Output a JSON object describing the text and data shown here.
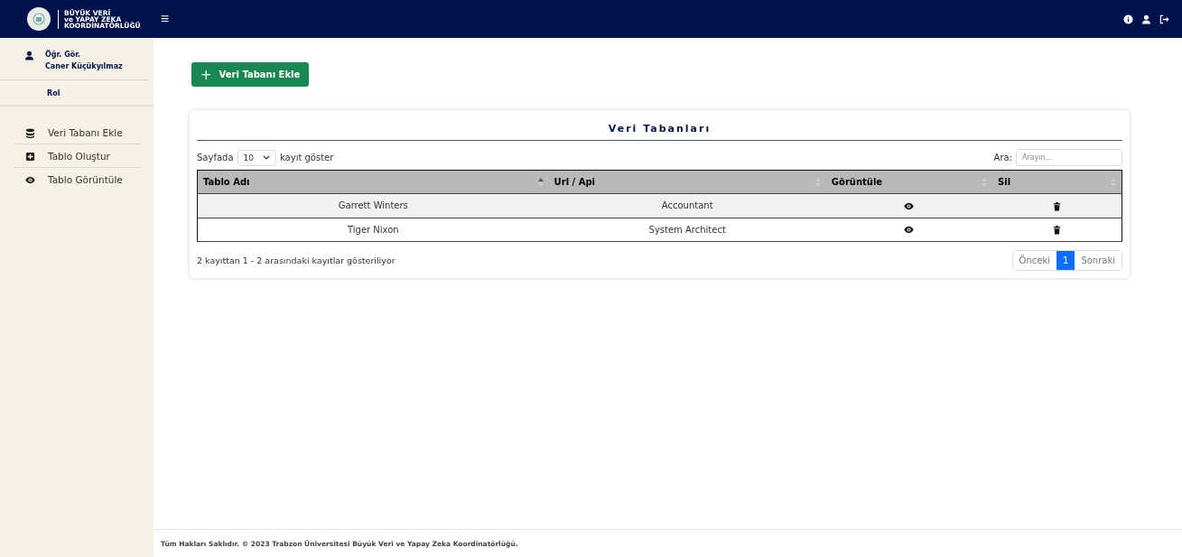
{
  "header": {
    "logo_lines": [
      "BÜYÜK VERİ",
      "ve YAPAY ZEKA",
      "KOORDİNATÖRLÜĞÜ"
    ],
    "menu_glyph": "≡"
  },
  "sidebar": {
    "user": {
      "title": "Öğr. Gör.",
      "name": "Caner Küçükyılmaz"
    },
    "role": "Rol",
    "items": [
      {
        "label": "Veri Tabanı Ekle",
        "kind": "database",
        "selected": false
      },
      {
        "label": "Tablo Oluştur",
        "kind": "plus-square",
        "selected": false
      },
      {
        "label": "Tablo Görüntüle",
        "kind": "eye",
        "selected": false
      }
    ]
  },
  "add_button": {
    "label": "Veri Tabanı Ekle",
    "glyph": "+"
  },
  "card": {
    "title": "Veri Tabanları",
    "page_size_prefix": "Sayfada",
    "page_size": "10",
    "page_size_suffix": "kayıt göster",
    "search_label": "Ara:",
    "search_placeholder": "Arayın...",
    "columns": [
      {
        "label": "Tablo Adı",
        "sorted": true
      },
      {
        "label": "Url / Api",
        "sorted": false
      },
      {
        "label": "Görüntüle",
        "sorted": false
      },
      {
        "label": "Sil",
        "sorted": false
      }
    ],
    "rows": [
      {
        "name": "Garrett Winters",
        "url": "Accountant"
      },
      {
        "name": "Tiger Nixon",
        "url": "System Architect"
      }
    ],
    "info": "2 kayıttan 1 - 2 arasındaki kayıtlar gösteriliyor",
    "pagination": {
      "previous": "Önceki",
      "next": "Sonraki",
      "pages": [
        {
          "label": "1",
          "selected": true
        }
      ]
    }
  },
  "footer": "Tüm Hakları Saklıdır. © 2023 Trabzon Üniversitesi Büyük Veri ve Yapay Zeka Koordinatörlüğü."
}
